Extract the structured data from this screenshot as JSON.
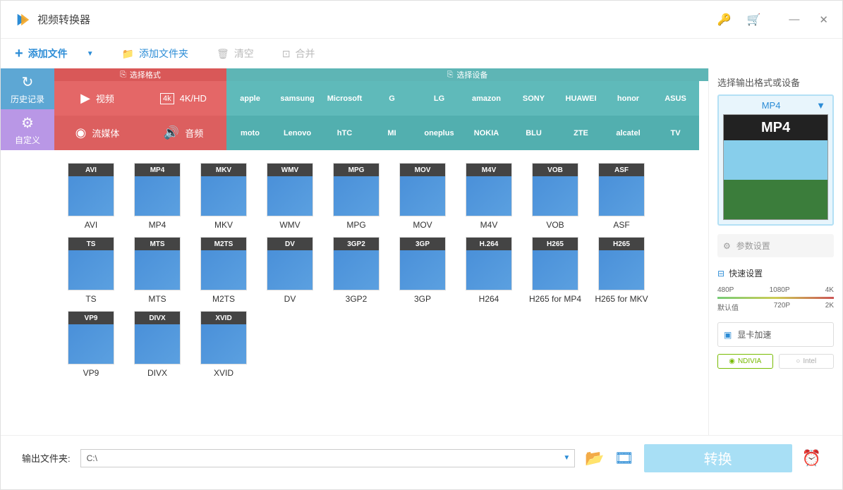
{
  "app": {
    "title": "视频转换器"
  },
  "toolbar": {
    "add_file": "添加文件",
    "add_folder": "添加文件夹",
    "clear": "清空",
    "merge": "合并"
  },
  "side": {
    "history": "历史记录",
    "custom": "自定义"
  },
  "category": {
    "format": "选择格式",
    "device": "选择设备"
  },
  "format_tabs": {
    "video": "视频",
    "hd": "4K/HD",
    "stream": "流媒体",
    "audio": "音频"
  },
  "brands_row1": [
    "apple",
    "samsung",
    "Microsoft",
    "G",
    "LG",
    "amazon",
    "SONY",
    "HUAWEI",
    "honor",
    "ASUS"
  ],
  "brands_row2": [
    "moto",
    "Lenovo",
    "hTC",
    "MI",
    "oneplus",
    "NOKIA",
    "BLU",
    "ZTE",
    "alcatel",
    "TV"
  ],
  "formats": [
    {
      "badge": "AVI",
      "label": "AVI"
    },
    {
      "badge": "MP4",
      "label": "MP4"
    },
    {
      "badge": "MKV",
      "label": "MKV"
    },
    {
      "badge": "WMV",
      "label": "WMV"
    },
    {
      "badge": "MPG",
      "label": "MPG"
    },
    {
      "badge": "MOV",
      "label": "MOV"
    },
    {
      "badge": "M4V",
      "label": "M4V"
    },
    {
      "badge": "VOB",
      "label": "VOB"
    },
    {
      "badge": "ASF",
      "label": "ASF"
    },
    {
      "badge": "TS",
      "label": "TS"
    },
    {
      "badge": "MTS",
      "label": "MTS"
    },
    {
      "badge": "M2TS",
      "label": "M2TS"
    },
    {
      "badge": "DV",
      "label": "DV"
    },
    {
      "badge": "3GP2",
      "label": "3GP2"
    },
    {
      "badge": "3GP",
      "label": "3GP"
    },
    {
      "badge": "H.264",
      "label": "H264"
    },
    {
      "badge": "H265",
      "label": "H265 for MP4"
    },
    {
      "badge": "H265",
      "label": "H265 for MKV"
    },
    {
      "badge": "VP9",
      "label": "VP9"
    },
    {
      "badge": "DIVX",
      "label": "DIVX"
    },
    {
      "badge": "XVID",
      "label": "XVID"
    }
  ],
  "right": {
    "title": "选择输出格式或设备",
    "selected": "MP4",
    "preview_badge": "MP4",
    "params": "参数设置",
    "quick": "快速设置",
    "scale1": [
      "480P",
      "1080P",
      "4K"
    ],
    "scale2": [
      "默认值",
      "720P",
      "2K"
    ],
    "gpu": "显卡加速",
    "nvidia": "NDIVIA",
    "intel": "Intel"
  },
  "bottom": {
    "out_label": "输出文件夹:",
    "path": "C:\\",
    "convert": "转换"
  }
}
